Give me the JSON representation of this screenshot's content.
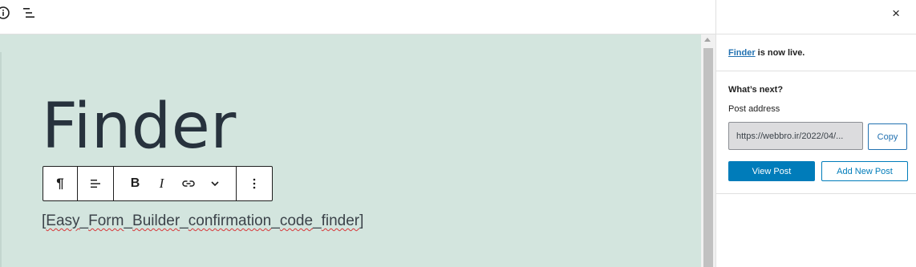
{
  "topbar": {
    "info_icon": "info-icon",
    "list_view_icon": "list-view-icon"
  },
  "editor": {
    "title": "Finder",
    "shortcode": {
      "open": "[",
      "words": [
        "Easy",
        "Form",
        "Builder",
        "confirmation",
        "code",
        "finder"
      ],
      "separator": "_",
      "close": "]"
    },
    "toolbar": {
      "paragraph_icon": "¶",
      "align_icon": "align-icon",
      "bold": "B",
      "italic": "I",
      "link_icon": "link-icon",
      "more_rich_icon": "chevron-down-icon",
      "options_icon": "more-vertical-icon"
    }
  },
  "panel": {
    "close_icon": "×",
    "live_link": "Finder",
    "live_text": " is now live.",
    "whats_next": "What’s next?",
    "post_address_label": "Post address",
    "post_address_value": "https://webbro.ir/2022/04/...",
    "copy_label": "Copy",
    "view_post_label": "View Post",
    "add_new_post_label": "Add New Post"
  },
  "colors": {
    "canvas_bg": "#d3e5de",
    "accent": "#007cba",
    "link": "#2271b1",
    "title_text": "#27323d"
  }
}
